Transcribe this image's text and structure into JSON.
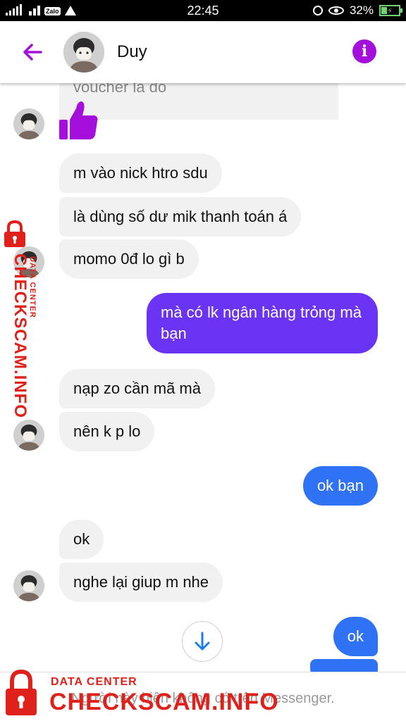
{
  "status_bar": {
    "time": "22:45",
    "battery": "32%",
    "icons": [
      "signal-icon",
      "wifi-icon",
      "zalo-icon",
      "warning-icon",
      "alarm-icon",
      "eye-icon",
      "battery-charging-icon"
    ],
    "zalo_label": "Zalo"
  },
  "header": {
    "back_icon": "arrow-left-icon",
    "contact_name": "Duy",
    "info_icon": "info-icon",
    "info_glyph": "i",
    "accent": "#a40fdb"
  },
  "messages": {
    "partial_top": "voucher là đó",
    "m1": "m vào nick htro sdu",
    "m2": "là dùng số dư mik thanh toán á",
    "m3": "momo 0đ lo gì b",
    "m4": "mà có lk ngân hàng trỏng mà bạn",
    "m5": "nạp zo cần mã mà",
    "m6": "nên k p lo",
    "m7": "ok bạn",
    "m8": "ok",
    "m9": "nghe lại giup m nhe",
    "m10": "ok"
  },
  "colors": {
    "incoming_bubble": "#f1f1f1",
    "outgoing_purple": "#6b34f5",
    "outgoing_blue": "#2f72f4",
    "like": "#a40fdb",
    "watermark": "#e0201b"
  },
  "footer": {
    "note": "Người này hiện không có trên Messenger."
  },
  "watermark": {
    "small": "DATA CENTER",
    "big": "CHECKSCAM.INFO"
  }
}
